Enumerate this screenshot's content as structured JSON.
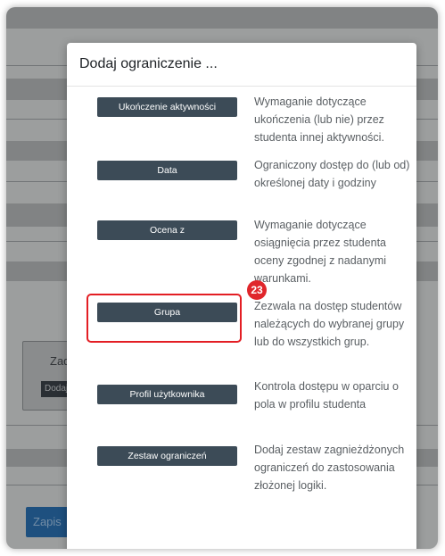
{
  "modal": {
    "title": "Dodaj ograniczenie ...",
    "options": [
      {
        "label": "Ukończenie aktywności",
        "description": "Wymaganie dotyczące ukończenia (lub nie) przez studenta innej aktywności."
      },
      {
        "label": "Data",
        "description": "Ograniczony dostęp do (lub od) określonej daty i godziny"
      },
      {
        "label": "Ocena z",
        "description": "Wymaganie dotyczące osiągnięcia przez studenta oceny zgodnej z nadanymi warunkami."
      },
      {
        "label": "Grupa",
        "description": "Zezwala na dostęp studentów należących do wybranej grupy lub do wszystkich grup."
      },
      {
        "label": "Profil użytkownika",
        "description": "Kontrola dostępu w oparciu o pola w profilu studenta"
      },
      {
        "label": "Zestaw ograniczeń",
        "description": "Dodaj zestaw zagnieżdżonych ograniczeń do zastosowania złożonej logiki."
      }
    ],
    "highlight_badge": "23"
  },
  "background": {
    "box_title": "Zad",
    "box_button": "Dodaj",
    "save_button": "Zapis"
  },
  "colors": {
    "button": "#3c4b57",
    "highlight": "#e31e24",
    "save": "#2a6fb0"
  }
}
